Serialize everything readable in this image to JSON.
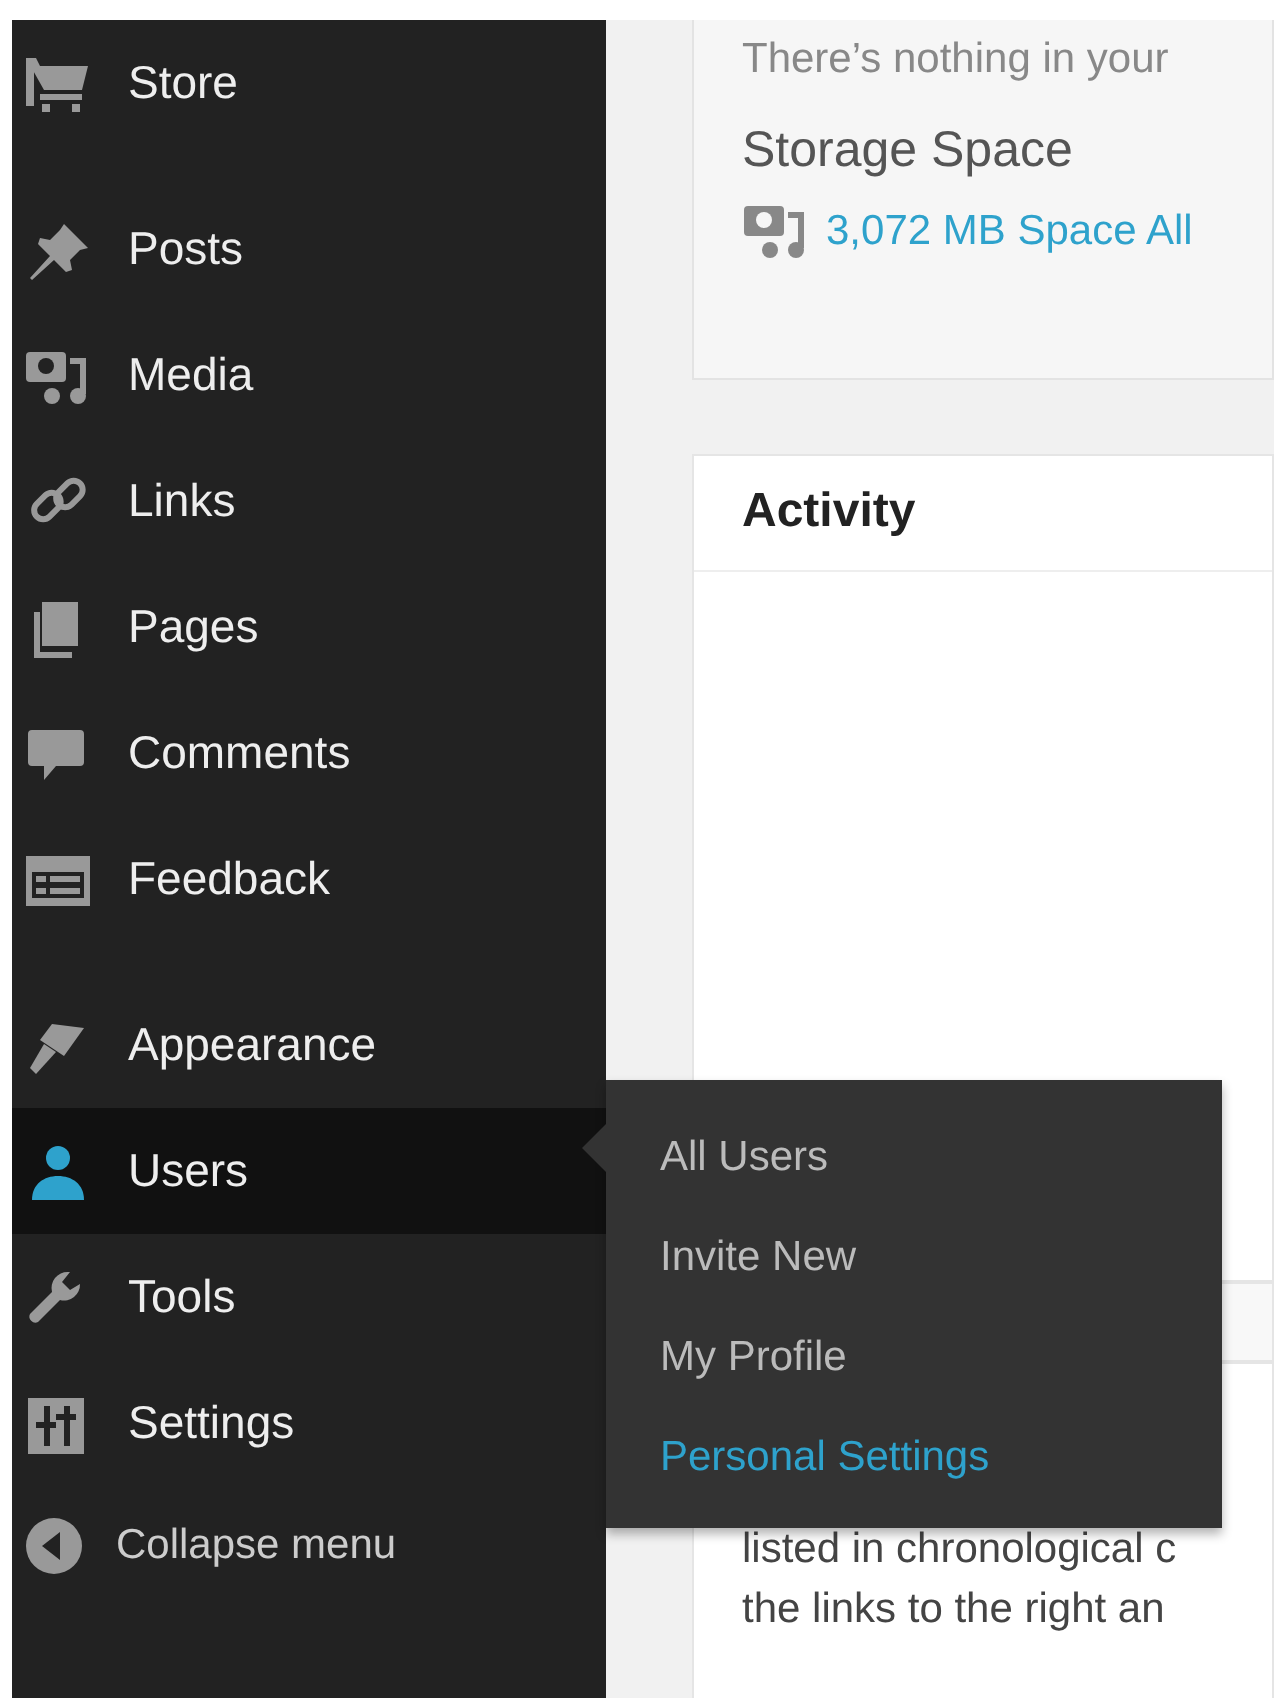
{
  "sidebar": {
    "sections": [
      [
        {
          "label": "Store",
          "selected": false
        }
      ],
      [
        {
          "label": "Posts",
          "selected": false
        },
        {
          "label": "Media",
          "selected": false
        },
        {
          "label": "Links",
          "selected": false
        },
        {
          "label": "Pages",
          "selected": false
        },
        {
          "label": "Comments",
          "selected": false
        },
        {
          "label": "Feedback",
          "selected": false
        }
      ],
      [
        {
          "label": "Appearance",
          "selected": false
        },
        {
          "label": "Users",
          "selected": true
        },
        {
          "label": "Tools",
          "selected": false
        },
        {
          "label": "Settings",
          "selected": false
        }
      ]
    ],
    "collapse": {
      "label": "Collapse menu"
    }
  },
  "submenu": {
    "items": [
      {
        "label": "All Users",
        "selected": false
      },
      {
        "label": "Invite New",
        "selected": false
      },
      {
        "label": "My Profile",
        "selected": false
      },
      {
        "label": "Personal Settings",
        "selected": true
      }
    ]
  },
  "storage_card": {
    "message": "There’s nothing in your",
    "heading": "Storage Space",
    "link": "3,072 MB Space All"
  },
  "activity_card": {
    "title": "Activity"
  },
  "posts_card": {
    "lines": [
      "listed in chronological c",
      "the links to the right an"
    ]
  }
}
